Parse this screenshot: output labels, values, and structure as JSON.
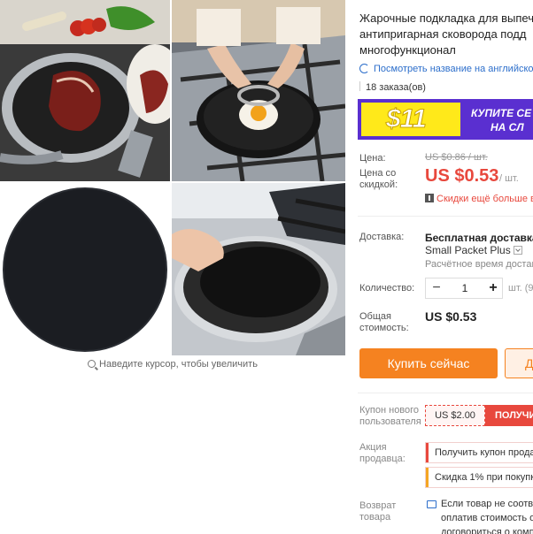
{
  "product": {
    "title": "Жарочные подкладка для выпечки антипригарная сковорода подд многофункционал",
    "translate_link": "Посмотреть название на английском",
    "orders": "18 заказа(ов)",
    "zoom_hint": "Наведите курсор, чтобы увеличить"
  },
  "banner": {
    "amount": "$11",
    "text_line1": "КУПИТЕ СЕ",
    "text_line2": "НА СЛ",
    "colors": {
      "background": "#5a2fd0",
      "highlight": "#ffe91a"
    }
  },
  "price": {
    "label": "Цена:",
    "original": "US $0.86 / шт.",
    "discount_label": "Цена со скидкой:",
    "discounted": "US $0.53",
    "unit": "/ шт.",
    "more_discounts": "Скидки ещё больше в",
    "accent_color": "#e8483d"
  },
  "shipping": {
    "label": "Доставка:",
    "free": "Бесплатная доставка в",
    "method": "Small Packet Plus",
    "estimate": "Расчётное время доставки"
  },
  "quantity": {
    "label": "Количество:",
    "minus": "−",
    "value": "1",
    "plus": "+",
    "available": "шт. (9"
  },
  "total": {
    "label": "Общая стоимость:",
    "value": "US $0.53"
  },
  "actions": {
    "buy_now": "Купить сейчас",
    "add_to_cart": "Д"
  },
  "coupons": {
    "new_user_label": "Купон нового пользователя",
    "new_user_value": "US $2.00",
    "new_user_action": "ПОЛУЧИ",
    "seller_label": "Акция продавца:",
    "seller_promo1": "Получить купон прода",
    "seller_promo2": "Скидка 1% при покупк"
  },
  "returns": {
    "label": "Возврат товара",
    "line1": "Если товар не соотве",
    "line2": "оплатив стоимость о",
    "line3": "договориться о комп"
  }
}
